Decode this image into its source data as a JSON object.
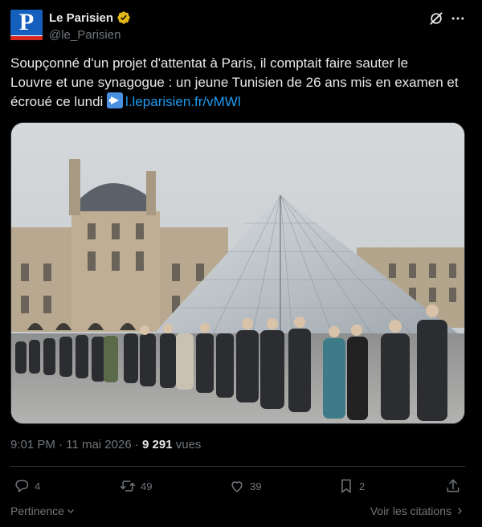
{
  "author": {
    "display_name": "Le Parisien",
    "handle": "@le_Parisien",
    "avatar_letter": "P"
  },
  "tweet": {
    "text_line1": "Soupçonné d'un projet d'attentat à Paris, il comptait faire sauter le",
    "text_line2": "Louvre et une synagogue : un jeune Tunisien de 26 ans mis en examen et",
    "text_line3": "écroué ce lundi",
    "link": "l.leparisien.fr/vMWl"
  },
  "meta": {
    "time": "9:01 PM",
    "separator": "·",
    "date": "11 mai 2026",
    "views_count": "9 291",
    "views_label": "vues"
  },
  "actions": {
    "replies": "4",
    "reposts": "49",
    "likes": "39",
    "bookmarks": "2"
  },
  "footer": {
    "relevance_label": "Pertinence",
    "quotes_label": "Voir les citations"
  },
  "colors": {
    "background": "#000000",
    "text": "#e7e9ea",
    "muted": "#71767b",
    "link": "#1d9bf0",
    "verified": "#e2b719",
    "brand": "#1560bd"
  },
  "icons": [
    "verified-badge-icon",
    "grok-icon",
    "more-icon",
    "reply-icon",
    "repost-icon",
    "like-icon",
    "bookmark-icon",
    "share-icon",
    "chevron-down-icon",
    "chevron-right-icon",
    "arrow-right-emoji"
  ]
}
